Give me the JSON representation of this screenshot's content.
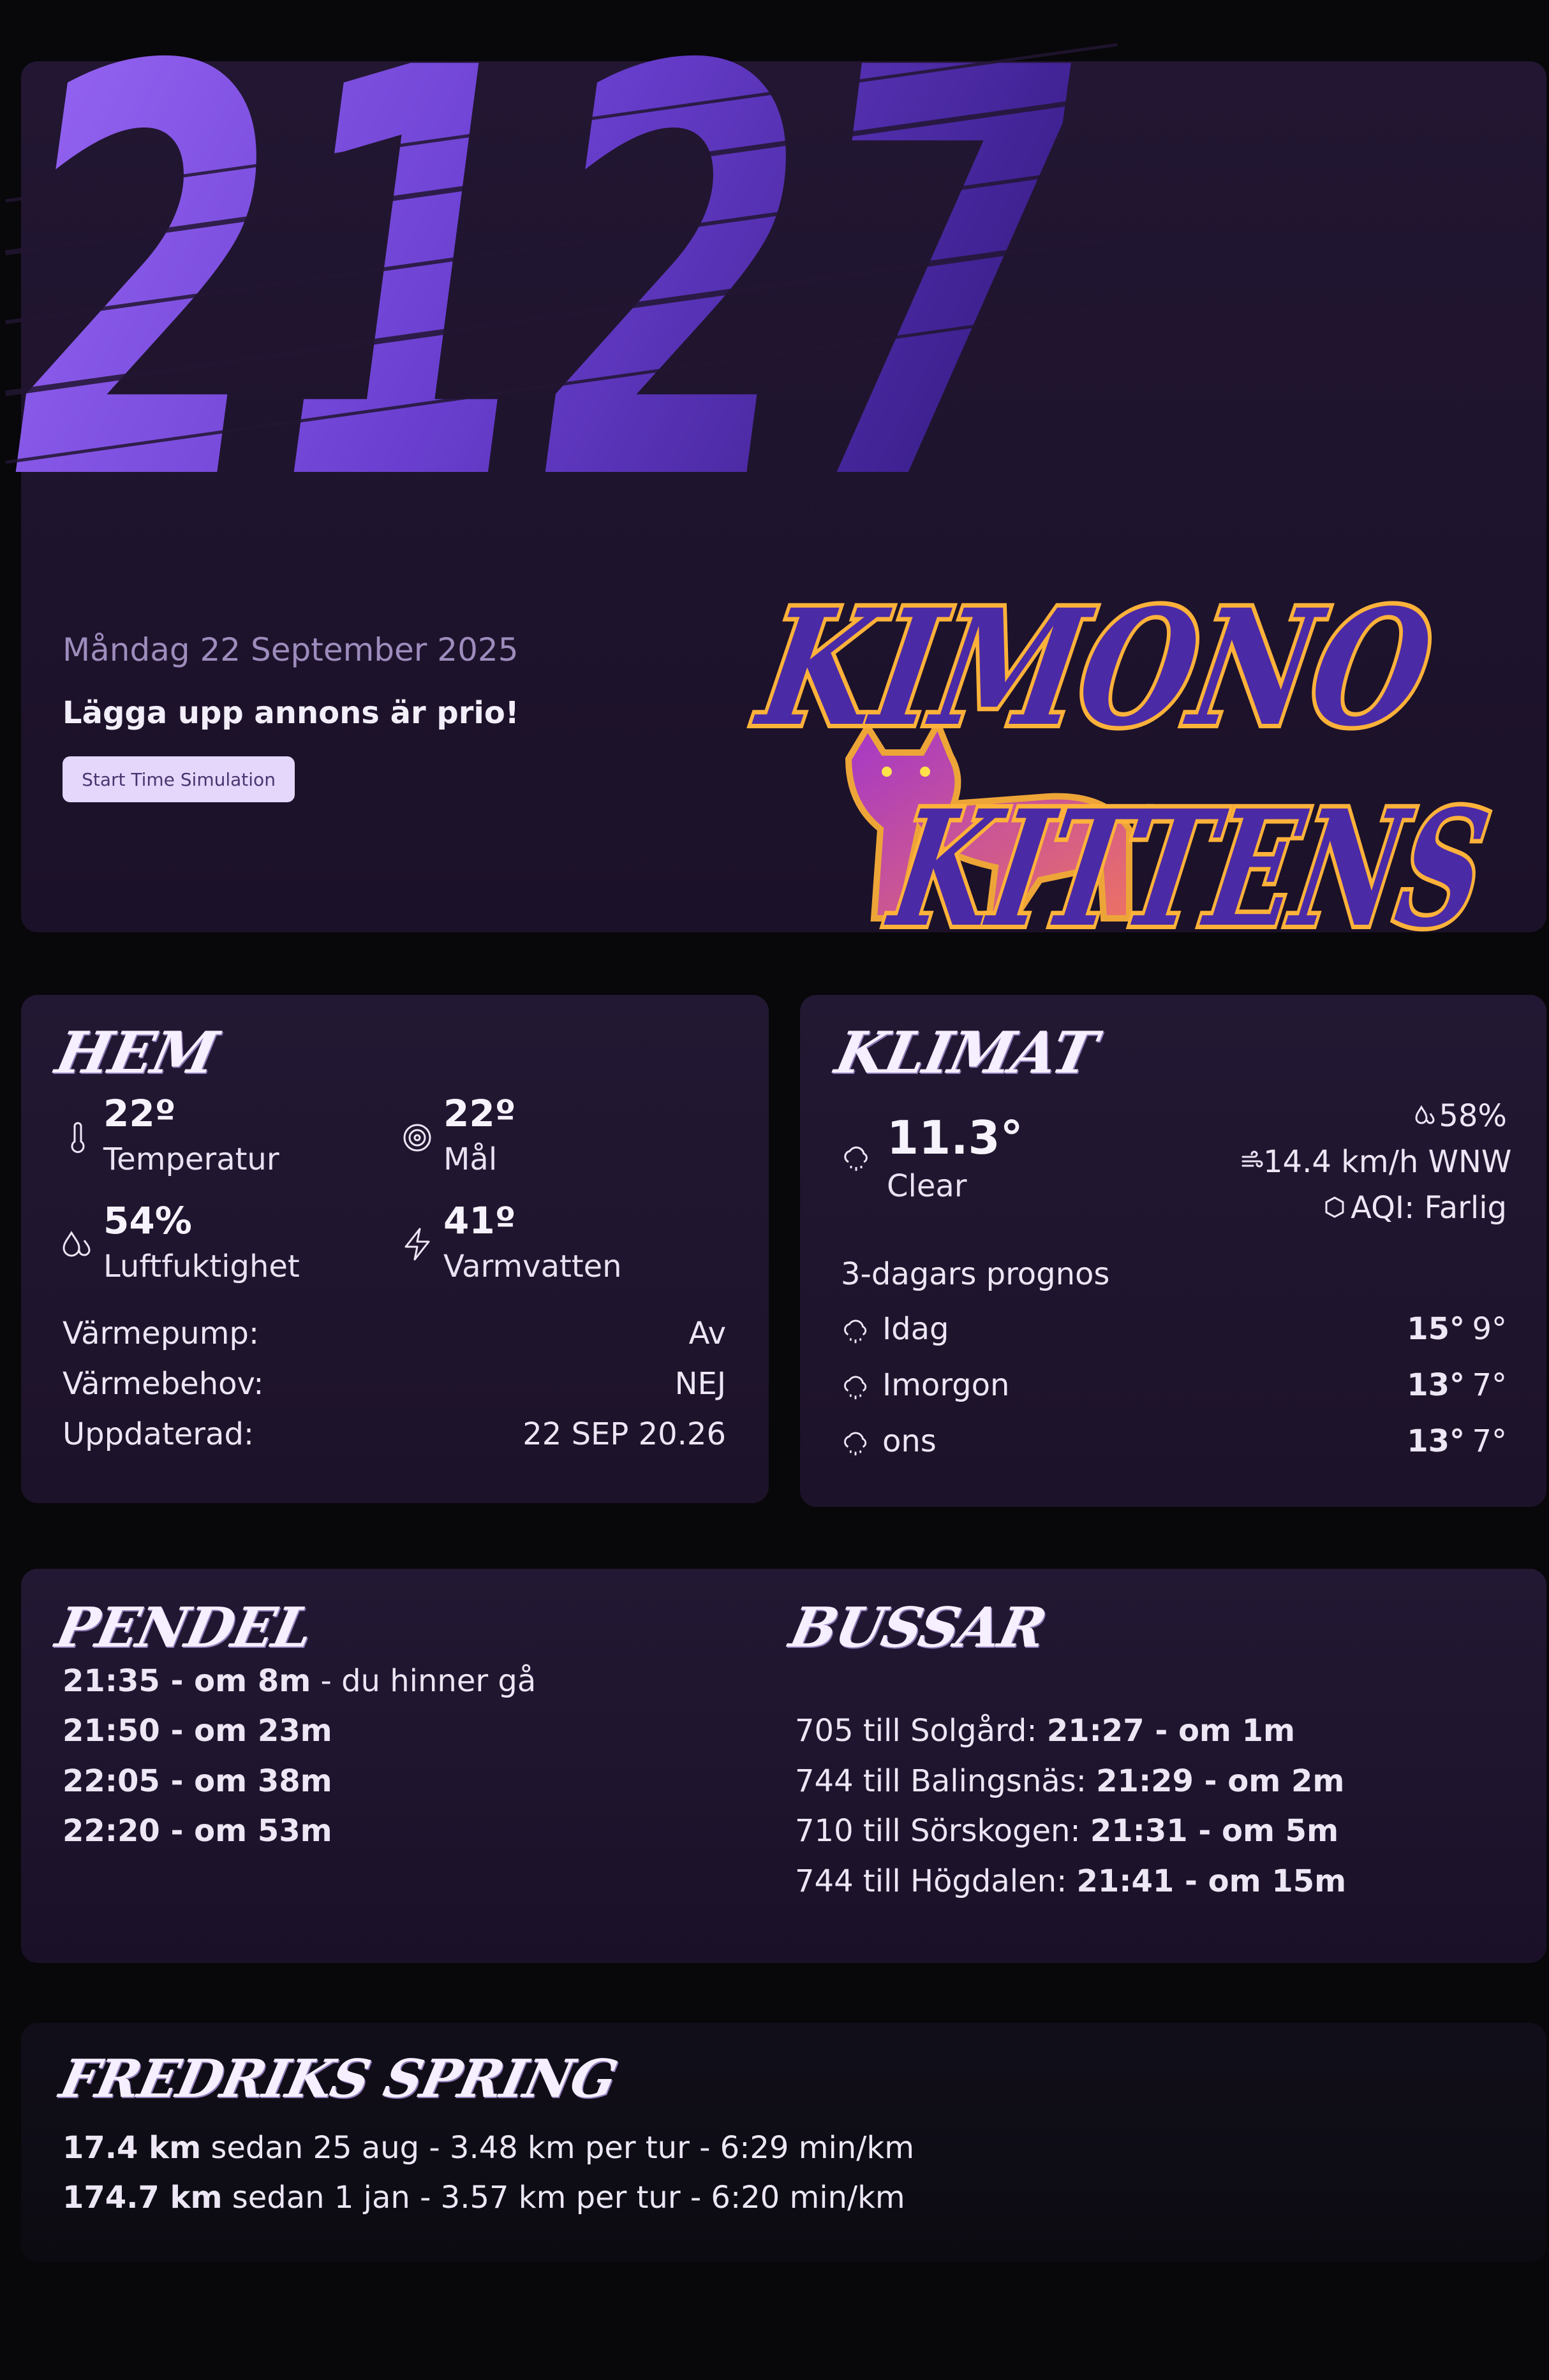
{
  "hero": {
    "clock": "2127",
    "date": "Måndag 22 September 2025",
    "note": "Lägga upp annons är prio!",
    "button_label": "Start Time Simulation",
    "logo_line1": "KIMONO",
    "logo_line2": "KITTENS"
  },
  "hem": {
    "title": "HEM",
    "stats": [
      {
        "value": "22º",
        "label": "Temperatur",
        "icon": "thermometer-icon"
      },
      {
        "value": "22º",
        "label": "Mål",
        "icon": "target-icon"
      },
      {
        "value": "54%",
        "label": "Luftfuktighet",
        "icon": "droplets-icon"
      },
      {
        "value": "41º",
        "label": "Varmvatten",
        "icon": "lightning-icon"
      }
    ],
    "rows": [
      {
        "key": "Värmepump:",
        "value": "Av"
      },
      {
        "key": "Värmebehov:",
        "value": "NEJ"
      },
      {
        "key": "Uppdaterad:",
        "value": "22 SEP 20.26"
      }
    ]
  },
  "klimat": {
    "title": "KLIMAT",
    "temp": "11.3°",
    "condition": "Clear",
    "humidity": "58%",
    "wind": "14.4 km/h WNW",
    "aqi": "AQI: Farlig",
    "forecast_title": "3-dagars prognos",
    "forecast": [
      {
        "day": "Idag",
        "high": "15°",
        "low": "9°"
      },
      {
        "day": "Imorgon",
        "high": "13°",
        "low": "7°"
      },
      {
        "day": "ons",
        "high": "13°",
        "low": "7°"
      }
    ]
  },
  "pendel": {
    "title": "PENDEL",
    "departures": [
      {
        "time": "21:35 - om 8m",
        "note": " - du hinner gå"
      },
      {
        "time": "21:50 - om 23m",
        "note": ""
      },
      {
        "time": "22:05 - om 38m",
        "note": ""
      },
      {
        "time": "22:20 - om 53m",
        "note": ""
      }
    ]
  },
  "bussar": {
    "title": "BUSSAR",
    "departures": [
      {
        "route": "705 till Solgård: ",
        "time": "21:27 - om 1m"
      },
      {
        "route": "744 till Balingsnäs: ",
        "time": "21:29 - om 2m"
      },
      {
        "route": "710 till Sörskogen: ",
        "time": "21:31 - om 5m"
      },
      {
        "route": "744 till Högdalen: ",
        "time": "21:41 - om 15m"
      }
    ]
  },
  "running": {
    "title": "FREDRIKS SPRING",
    "lines": [
      {
        "distance": "17.4 km",
        "rest": " sedan 25 aug - 3.48 km per tur - 6:29 min/km"
      },
      {
        "distance": "174.7 km",
        "rest": " sedan 1 jan - 3.57 km per tur - 6:20 min/km"
      }
    ]
  },
  "colors": {
    "background": "#08070a",
    "card": "#1f152d",
    "clock_start": "#8d5ff0",
    "clock_end": "#4a2a9a",
    "logo_orange": "#ffb23a",
    "logo_purple": "#4b2aa6",
    "logo_pink": "#d43ab0",
    "button": "#e4d7fb"
  }
}
